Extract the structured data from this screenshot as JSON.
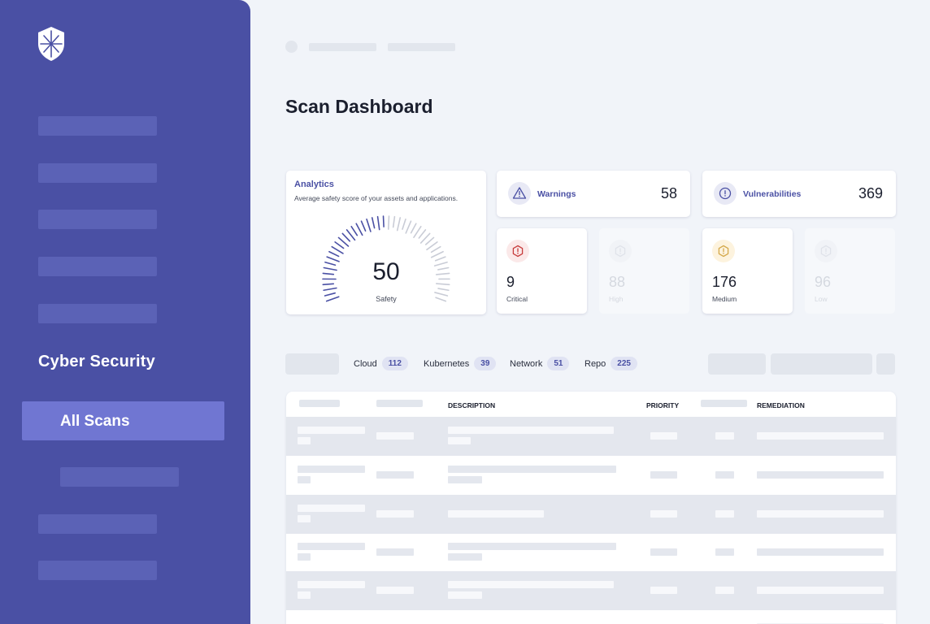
{
  "sidebar": {
    "section_title": "Cyber Security",
    "active_item": "All Scans"
  },
  "page": {
    "title": "Scan Dashboard"
  },
  "analytics": {
    "title": "Analytics",
    "description": "Average safety score of your assets and applications.",
    "score": "50",
    "score_fraction": 0.5,
    "score_label": "Safety"
  },
  "stats": [
    {
      "label": "Warnings",
      "value": "58",
      "icon": "warning-triangle-icon"
    },
    {
      "label": "Vulnerabilities",
      "value": "369",
      "icon": "alert-circle-icon"
    }
  ],
  "severity": [
    {
      "label": "Critical",
      "value": "9",
      "icon": "hexagon-alert-icon",
      "color": "#c73c3c"
    },
    {
      "label": "High",
      "value": "88",
      "icon": "hexagon-alert-icon",
      "color": "#e0e3ea"
    },
    {
      "label": "Medium",
      "value": "176",
      "icon": "hexagon-alert-icon",
      "color": "#d4a84a"
    },
    {
      "label": "Low",
      "value": "96",
      "icon": "hexagon-alert-icon",
      "color": "#e0e3ea"
    }
  ],
  "filters": [
    {
      "label": "Cloud",
      "count": "112"
    },
    {
      "label": "Kubernetes",
      "count": "39"
    },
    {
      "label": "Network",
      "count": "51"
    },
    {
      "label": "Repo",
      "count": "225"
    }
  ],
  "table": {
    "columns": {
      "description": "DESCRIPTION",
      "priority": "PRIORITY",
      "remediation": "REMEDIATION"
    }
  },
  "colors": {
    "sidebar": "#4a50a4",
    "accent": "#4a50a4",
    "active_nav": "#7076d2",
    "gauge_active": "#4a50a4",
    "gauge_inactive": "#c9ccd6"
  }
}
